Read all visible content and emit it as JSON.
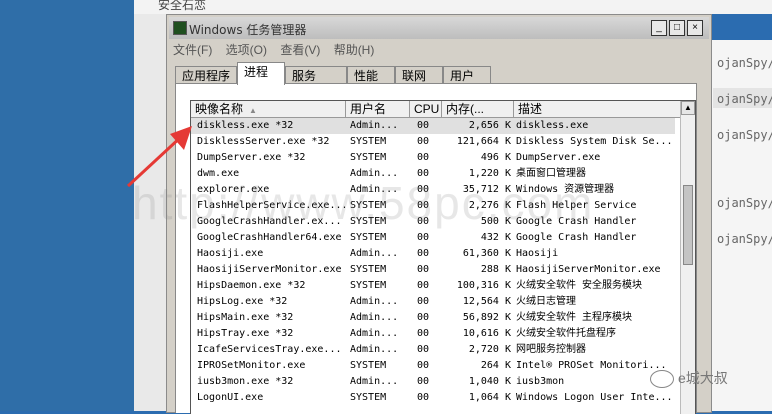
{
  "background": {
    "top_label": "安全石恋",
    "right_items": [
      "ojanSpy/",
      "ojanSpy/Q",
      "ojanSpy/Q",
      "ojanSpy/Q",
      "ojanSpy/Q"
    ],
    "watermark_right": "e城大叔",
    "watermark_center": "http://www.58pc.com"
  },
  "window": {
    "title": "Windows 任务管理器",
    "buttons": [
      "_",
      "□",
      "×"
    ]
  },
  "menu": [
    "文件(F)",
    "选项(O)",
    "查看(V)",
    "帮助(H)"
  ],
  "tabs": [
    "应用程序",
    "进程",
    "服务",
    "性能",
    "联网",
    "用户"
  ],
  "active_tab": "进程",
  "columns": [
    "映像名称",
    "用户名",
    "CPU",
    "内存(...",
    "描述"
  ],
  "processes": [
    {
      "name": "diskless.exe *32",
      "user": "Admin...",
      "cpu": "00",
      "mem": "2,656 K",
      "desc": "diskless.exe"
    },
    {
      "name": "DisklessServer.exe *32",
      "user": "SYSTEM",
      "cpu": "00",
      "mem": "121,664 K",
      "desc": "Diskless System Disk Se..."
    },
    {
      "name": "DumpServer.exe *32",
      "user": "SYSTEM",
      "cpu": "00",
      "mem": "496 K",
      "desc": "DumpServer.exe"
    },
    {
      "name": "dwm.exe",
      "user": "Admin...",
      "cpu": "00",
      "mem": "1,220 K",
      "desc": "桌面窗口管理器"
    },
    {
      "name": "explorer.exe",
      "user": "Admin...",
      "cpu": "00",
      "mem": "35,712 K",
      "desc": "Windows 资源管理器"
    },
    {
      "name": "FlashHelperService.exe...",
      "user": "SYSTEM",
      "cpu": "00",
      "mem": "2,276 K",
      "desc": "Flash Helper Service"
    },
    {
      "name": "GoogleCrashHandler.ex...",
      "user": "SYSTEM",
      "cpu": "00",
      "mem": "500 K",
      "desc": "Google Crash Handler"
    },
    {
      "name": "GoogleCrashHandler64.exe",
      "user": "SYSTEM",
      "cpu": "00",
      "mem": "432 K",
      "desc": "Google Crash Handler"
    },
    {
      "name": "Haosiji.exe",
      "user": "Admin...",
      "cpu": "00",
      "mem": "61,360 K",
      "desc": "Haosiji"
    },
    {
      "name": "HaosijiServerMonitor.exe",
      "user": "SYSTEM",
      "cpu": "00",
      "mem": "288 K",
      "desc": "HaosijiServerMonitor.exe"
    },
    {
      "name": "HipsDaemon.exe *32",
      "user": "SYSTEM",
      "cpu": "00",
      "mem": "100,316 K",
      "desc": "火绒安全软件 安全服务模块"
    },
    {
      "name": "HipsLog.exe *32",
      "user": "Admin...",
      "cpu": "00",
      "mem": "12,564 K",
      "desc": "火绒日志管理"
    },
    {
      "name": "HipsMain.exe *32",
      "user": "Admin...",
      "cpu": "00",
      "mem": "56,892 K",
      "desc": "火绒安全软件 主程序模块"
    },
    {
      "name": "HipsTray.exe *32",
      "user": "Admin...",
      "cpu": "00",
      "mem": "10,616 K",
      "desc": "火绒安全软件托盘程序"
    },
    {
      "name": "IcafeServicesTray.exe...",
      "user": "Admin...",
      "cpu": "00",
      "mem": "2,720 K",
      "desc": "网吧服务控制器"
    },
    {
      "name": "IPROSetMonitor.exe",
      "user": "SYSTEM",
      "cpu": "00",
      "mem": "264 K",
      "desc": "Intel® PROSet Monitori..."
    },
    {
      "name": "iusb3mon.exe *32",
      "user": "Admin...",
      "cpu": "00",
      "mem": "1,040 K",
      "desc": "iusb3mon"
    },
    {
      "name": "LogonUI.exe",
      "user": "SYSTEM",
      "cpu": "00",
      "mem": "1,064 K",
      "desc": "Windows Logon User Inte..."
    }
  ],
  "colors": {
    "arrow": "#e53935",
    "desktop": "#2f6ea8",
    "window_face": "#d4d0c8"
  }
}
